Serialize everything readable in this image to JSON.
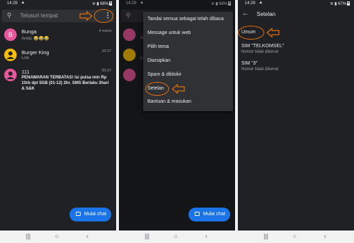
{
  "status": {
    "p1": {
      "time": "14:29",
      "battery": "68%"
    },
    "p2": {
      "time": "14:29",
      "battery": "68%"
    },
    "p3": {
      "time": "14:29",
      "battery": "67%"
    }
  },
  "panel1": {
    "search_placeholder": "Telusuri tempat",
    "conversations": [
      {
        "initial": "B",
        "name": "Bunga",
        "time": "4 menit",
        "snippet": "Anda: 😂😂😂",
        "avatar_color": "#e8579a"
      },
      {
        "initial": "",
        "name": "Burger King",
        "time": "10:27",
        "snippet": "Link",
        "avatar_color": "#fbbc04"
      },
      {
        "initial": "",
        "name": "111",
        "time": "09:07",
        "snippet": "PENAWARAN TERBATAS! Isi pulsa min Rp 10rb dpt 5GB (01-12) 2hr. SMS Berlaku 3hari & S&K",
        "avatar_color": "#e8579a"
      }
    ],
    "fab_label": "Mulai chat"
  },
  "panel2": {
    "menu": [
      "Tandai semua sebagai telah dibaca",
      "Message untuk web",
      "Pilih tema",
      "Diarsipkan",
      "Spam & diblokir",
      "Setelan",
      "Bantuan & masukan"
    ],
    "fab_label": "Mulai chat"
  },
  "panel3": {
    "title": "Setelan",
    "items": [
      {
        "title": "Umum",
        "subtitle": ""
      },
      {
        "title": "SIM \"TELKOMSEL\"",
        "subtitle": "Nomor tidak dikenal"
      },
      {
        "title": "SIM \"3\"",
        "subtitle": "Nomor tidak dikenal"
      }
    ]
  },
  "colors": {
    "annotation": "#e8710a",
    "accent": "#1a73e8",
    "background": "#202124"
  }
}
